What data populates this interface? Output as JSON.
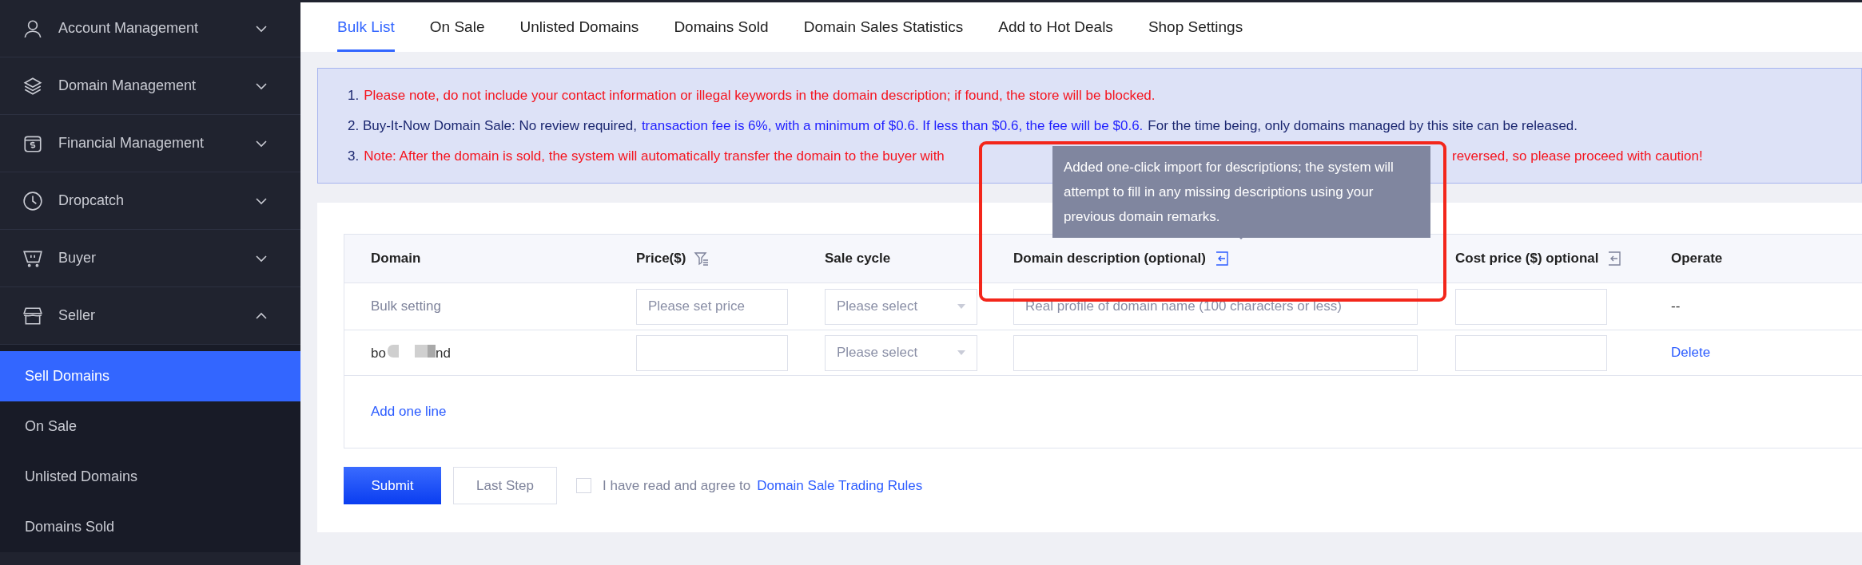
{
  "sidebar": {
    "items": [
      {
        "kind": "user",
        "label": "Account Management",
        "expanded": false
      },
      {
        "kind": "layers",
        "label": "Domain Management",
        "expanded": false
      },
      {
        "kind": "wallet",
        "label": "Financial Management",
        "expanded": false
      },
      {
        "kind": "clock",
        "label": "Dropcatch",
        "expanded": false
      },
      {
        "kind": "cart",
        "label": "Buyer",
        "expanded": false
      },
      {
        "kind": "store",
        "label": "Seller",
        "expanded": true,
        "children": [
          {
            "label": "Sell Domains",
            "selected": true
          },
          {
            "label": "On Sale",
            "selected": false
          },
          {
            "label": "Unlisted Domains",
            "selected": false
          },
          {
            "label": "Domains Sold",
            "selected": false
          }
        ]
      }
    ]
  },
  "tabs": [
    {
      "label": "Bulk List",
      "selected": true
    },
    {
      "label": "On Sale",
      "selected": false
    },
    {
      "label": "Unlisted Domains",
      "selected": false
    },
    {
      "label": "Domains Sold",
      "selected": false
    },
    {
      "label": "Domain Sales Statistics",
      "selected": false
    },
    {
      "label": "Add to Hot Deals",
      "selected": false
    },
    {
      "label": "Shop Settings",
      "selected": false
    }
  ],
  "notice": {
    "lines": [
      {
        "segments": [
          {
            "text": "1.",
            "color": "#1b2770"
          },
          {
            "text": "Please note, do not include your contact information or illegal keywords in the domain description; if found, the store will be blocked.",
            "color": "#f5141e"
          }
        ]
      },
      {
        "segments": [
          {
            "text": "2. Buy-It-Now Domain Sale: No review required,",
            "color": "#1b2770"
          },
          {
            "text": "transaction fee is 6%, with a minimum of $0.6. If less than $0.6, the fee will be $0.6.",
            "color": "#1f1fff"
          },
          {
            "text": "For the time being, only domains managed by this site can be released.",
            "color": "#1b2770"
          }
        ]
      },
      {
        "segments": [
          {
            "text": "3.",
            "color": "#1b2770"
          },
          {
            "text": "Note: After the domain is sold, the system will automatically transfer the domain to the buyer with",
            "color": "#f5141e",
            "covered_after": true
          },
          {
            "text": "reversed, so please proceed with caution!",
            "color": "#f5141e"
          }
        ]
      }
    ]
  },
  "tooltip": {
    "text": "Added one-click import for descriptions; the system will attempt to fill in any missing descriptions using your previous domain remarks."
  },
  "table": {
    "columns": [
      {
        "label": "Domain",
        "kind": "plain"
      },
      {
        "label": "Price($)",
        "kind": "filter"
      },
      {
        "label": "Sale cycle",
        "kind": "plain"
      },
      {
        "label": "Domain description (optional)",
        "kind": "import",
        "highlighted": true
      },
      {
        "label": "Cost price ($) optional",
        "kind": "import",
        "highlighted": false
      },
      {
        "label": "Operate",
        "kind": "plain"
      }
    ],
    "rows": [
      {
        "kind": "bulk",
        "domain": "Bulk setting",
        "price_placeholder": "Please set price",
        "sale_cycle_placeholder": "Please select",
        "description_placeholder": "Real profile of domain name (100 characters or less)",
        "operate": "--"
      },
      {
        "kind": "domain",
        "domain_start": "bo",
        "domain_end": "nd",
        "sale_cycle_placeholder": "Please select",
        "operate": "Delete"
      }
    ],
    "add_line": "Add one line"
  },
  "footer": {
    "submit": "Submit",
    "last_step": "Last Step",
    "agreement": {
      "checked": false,
      "text": "I have read and agree to",
      "link": "Domain Sale Trading Rules"
    }
  }
}
